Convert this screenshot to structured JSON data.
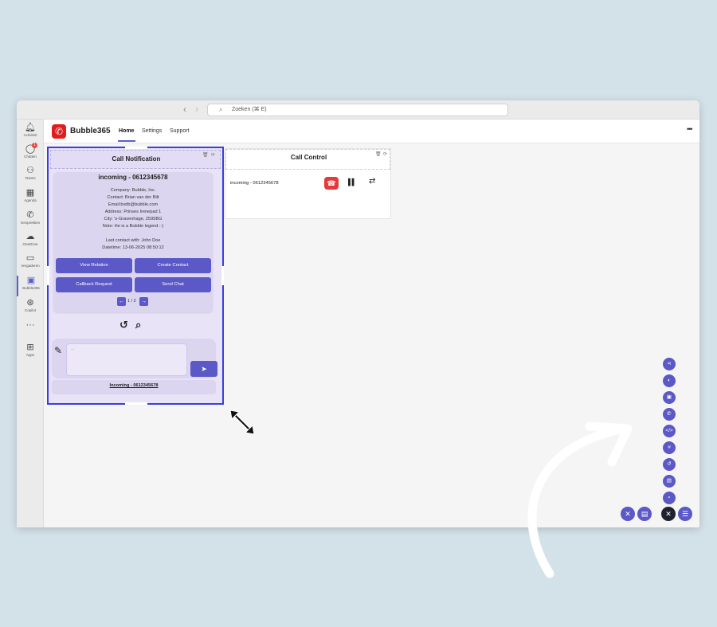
{
  "window": {
    "search_placeholder": "Zoeken (⌘ E)"
  },
  "rail": {
    "items": [
      {
        "icon": "bell-icon",
        "label": "Activiteit"
      },
      {
        "icon": "chat-icon",
        "label": "Chatten",
        "badge": "1"
      },
      {
        "icon": "teams-icon",
        "label": "Teams"
      },
      {
        "icon": "calendar-icon",
        "label": "Agenda"
      },
      {
        "icon": "phone-icon",
        "label": "Gesprekken"
      },
      {
        "icon": "cloud-icon",
        "label": "OneDrive"
      },
      {
        "icon": "video-icon",
        "label": "Vergaderen"
      },
      {
        "icon": "bubble365-icon",
        "label": "Bubble365"
      },
      {
        "icon": "copilot-icon",
        "label": "Copilot"
      },
      {
        "icon": "more-icon",
        "label": ""
      },
      {
        "icon": "apps-icon",
        "label": "Apps"
      }
    ]
  },
  "app": {
    "brand": "Bubble365",
    "tabs": [
      "Home",
      "Settings",
      "Support"
    ],
    "more": "•••"
  },
  "notification": {
    "title": "Call Notification",
    "card_title": "incoming - 0612345678",
    "lines": [
      "Company: Bubble, Inc.",
      "Contact: Brian van der Bilt",
      "Email:bvdb@bubble.com",
      "Address: Prinses Irenepad 1",
      "City: 's-Gravenhage, 2595BG",
      "Note: He is a Bubble legend :-)",
      "",
      "Last contact with: John Doe",
      "Datetime: 13-06-2025 08:50:12"
    ],
    "buttons": [
      "View Relation",
      "Create Contact",
      "Callback Request",
      "Send Chat"
    ],
    "pager": "1 / 2",
    "chat_placeholder": "...",
    "footer": "Incoming - 0612345678"
  },
  "control": {
    "title": "Call Control",
    "call_label": "incoming - 0612345678"
  },
  "colors": {
    "accent": "#5b58c7",
    "selection": "#3b3de0",
    "hangup": "#e33a3a",
    "logo": "#e11d1d"
  }
}
